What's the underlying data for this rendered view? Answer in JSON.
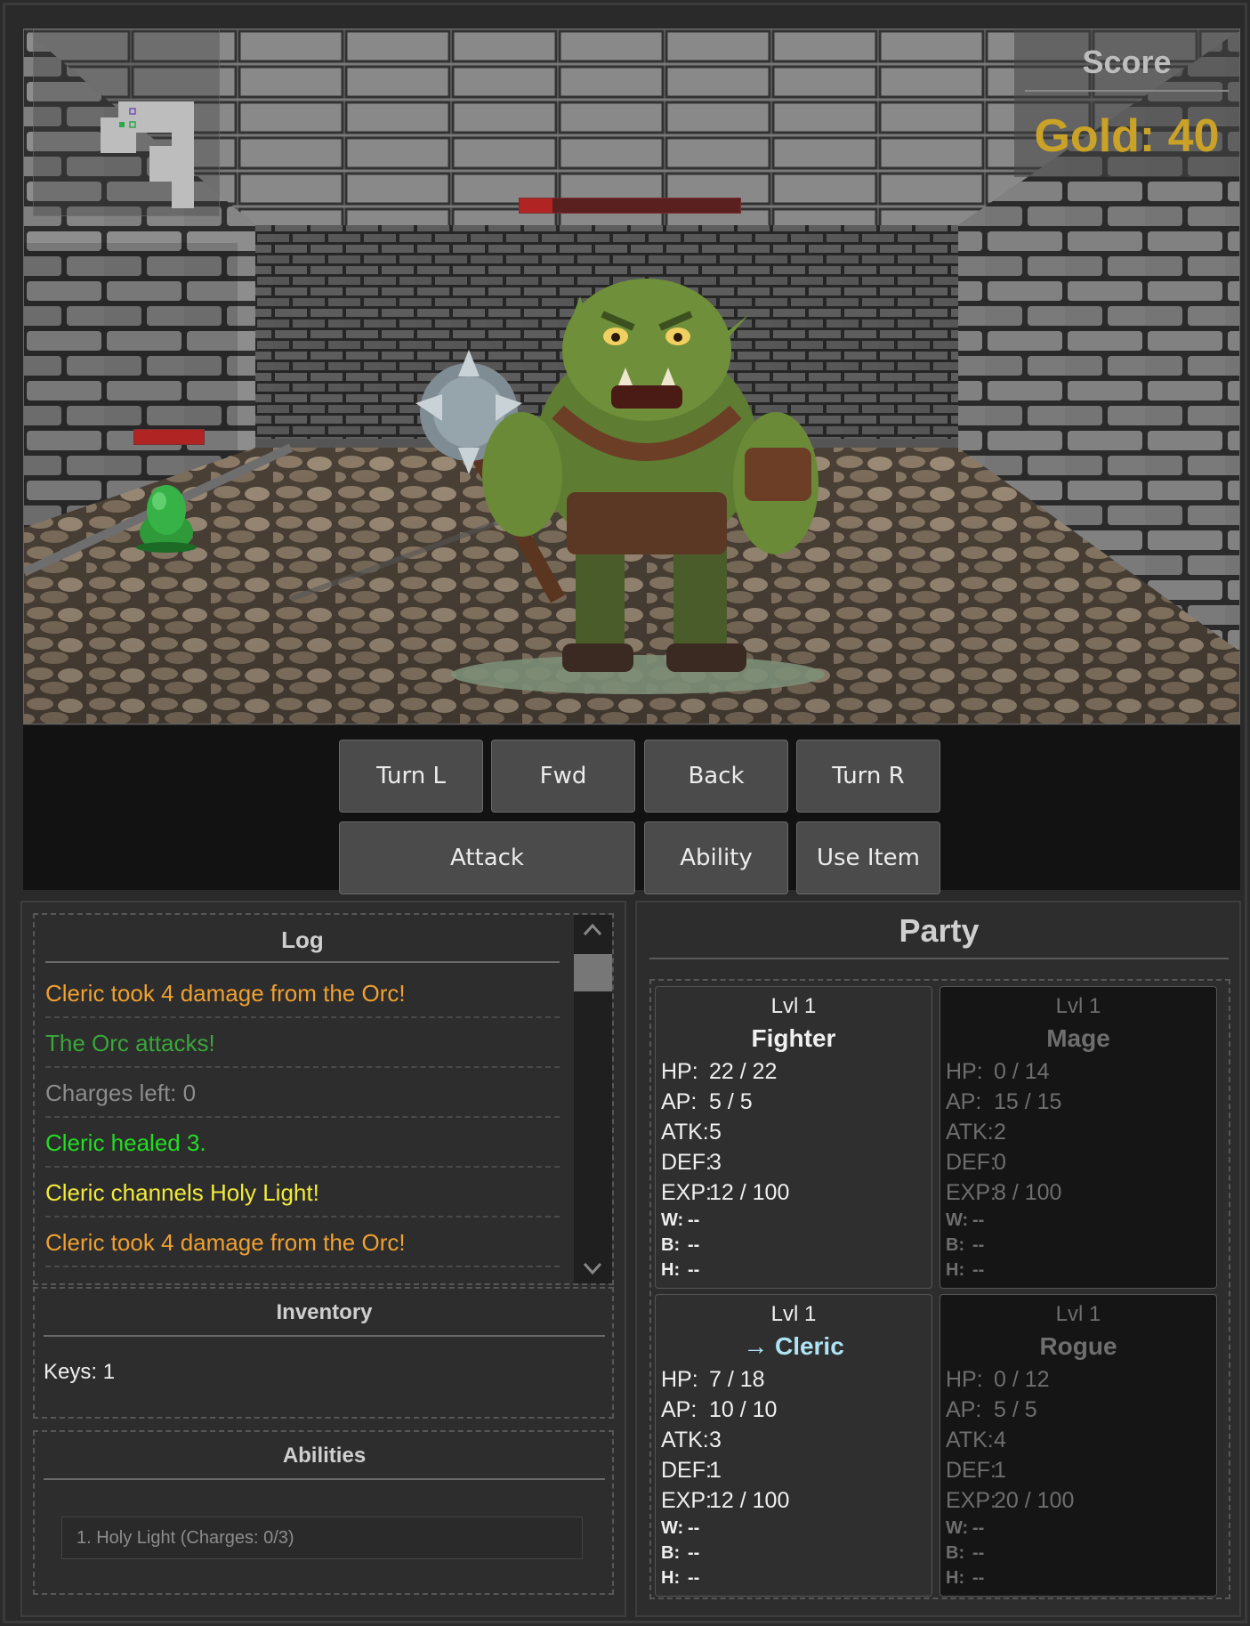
{
  "hud": {
    "score_title": "Score",
    "gold_label": "Gold: 40"
  },
  "enemies": [
    {
      "name": "Orc",
      "hp_fraction": 0.15
    },
    {
      "name": "Slime",
      "hp_fraction": 1.0
    }
  ],
  "controls": {
    "turn_left": "Turn L",
    "forward": "Fwd",
    "back": "Back",
    "turn_right": "Turn R",
    "attack": "Attack",
    "ability": "Ability",
    "use_item": "Use Item"
  },
  "log": {
    "title": "Log",
    "entries": [
      {
        "text": "Cleric took 4 damage from the Orc!",
        "color": "#f0a030"
      },
      {
        "text": "The Orc attacks!",
        "color": "#3aa63a"
      },
      {
        "text": "Charges left: 0",
        "color": "#8c8c8c"
      },
      {
        "text": "Cleric healed 3.",
        "color": "#22dd22"
      },
      {
        "text": "Cleric channels Holy Light!",
        "color": "#f2ea3a"
      },
      {
        "text": "Cleric took 4 damage from the Orc!",
        "color": "#f0a030"
      }
    ]
  },
  "inventory": {
    "title": "Inventory",
    "keys": "Keys: 1"
  },
  "abilities": {
    "title": "Abilities",
    "items": [
      "1. Holy Light (Charges: 0/3)"
    ]
  },
  "party": {
    "title": "Party",
    "members": [
      {
        "level": "Lvl 1",
        "name": "Fighter",
        "hp": "22 / 22",
        "ap": "5 / 5",
        "atk": "5",
        "def": "3",
        "exp": "12 / 100",
        "w": "--",
        "b": "--",
        "h": "--",
        "alive": true,
        "active": false
      },
      {
        "level": "Lvl 1",
        "name": "Mage",
        "hp": "0 / 14",
        "ap": "15 / 15",
        "atk": "2",
        "def": "0",
        "exp": "8 / 100",
        "w": "--",
        "b": "--",
        "h": "--",
        "alive": false,
        "active": false
      },
      {
        "level": "Lvl 1",
        "name": "→ Cleric",
        "hp": "7 / 18",
        "ap": "10 / 10",
        "atk": "3",
        "def": "1",
        "exp": "12 / 100",
        "w": "--",
        "b": "--",
        "h": "--",
        "alive": true,
        "active": true
      },
      {
        "level": "Lvl 1",
        "name": "Rogue",
        "hp": "0 / 12",
        "ap": "5 / 5",
        "atk": "4",
        "def": "1",
        "exp": "20 / 100",
        "w": "--",
        "b": "--",
        "h": "--",
        "alive": false,
        "active": false
      }
    ],
    "stat_labels": {
      "hp": "HP:",
      "ap": "AP:",
      "atk": "ATK:",
      "def": "DEF:",
      "exp": "EXP:",
      "w": "W:",
      "b": "B:",
      "h": "H:"
    }
  },
  "colors": {
    "gold": "#c9a227",
    "active_member": "#aee4f5",
    "hp_bar": "#b02424"
  }
}
